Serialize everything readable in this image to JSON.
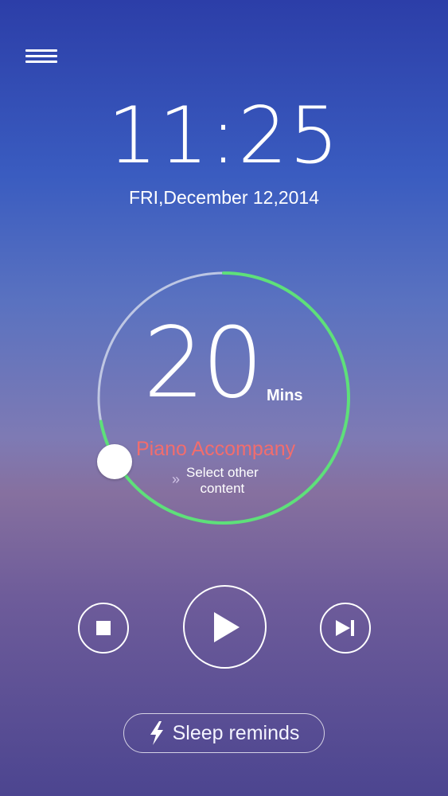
{
  "clock": {
    "time": "11:25",
    "date": "FRI,December 12,2014"
  },
  "timer": {
    "minutes": "20",
    "unit": "Mins",
    "progress_fraction": 0.72,
    "track_color": "#cfd6ea",
    "progress_color": "#5ee07a"
  },
  "content": {
    "title": "Piano Accompany",
    "select_line1": "Select other",
    "select_line2": "content",
    "title_color": "#f26d6d"
  },
  "controls": {
    "stop_icon": "stop-icon",
    "play_icon": "play-icon",
    "next_icon": "skip-next-icon"
  },
  "sleep": {
    "label": "Sleep reminds",
    "icon": "lightning-icon"
  }
}
